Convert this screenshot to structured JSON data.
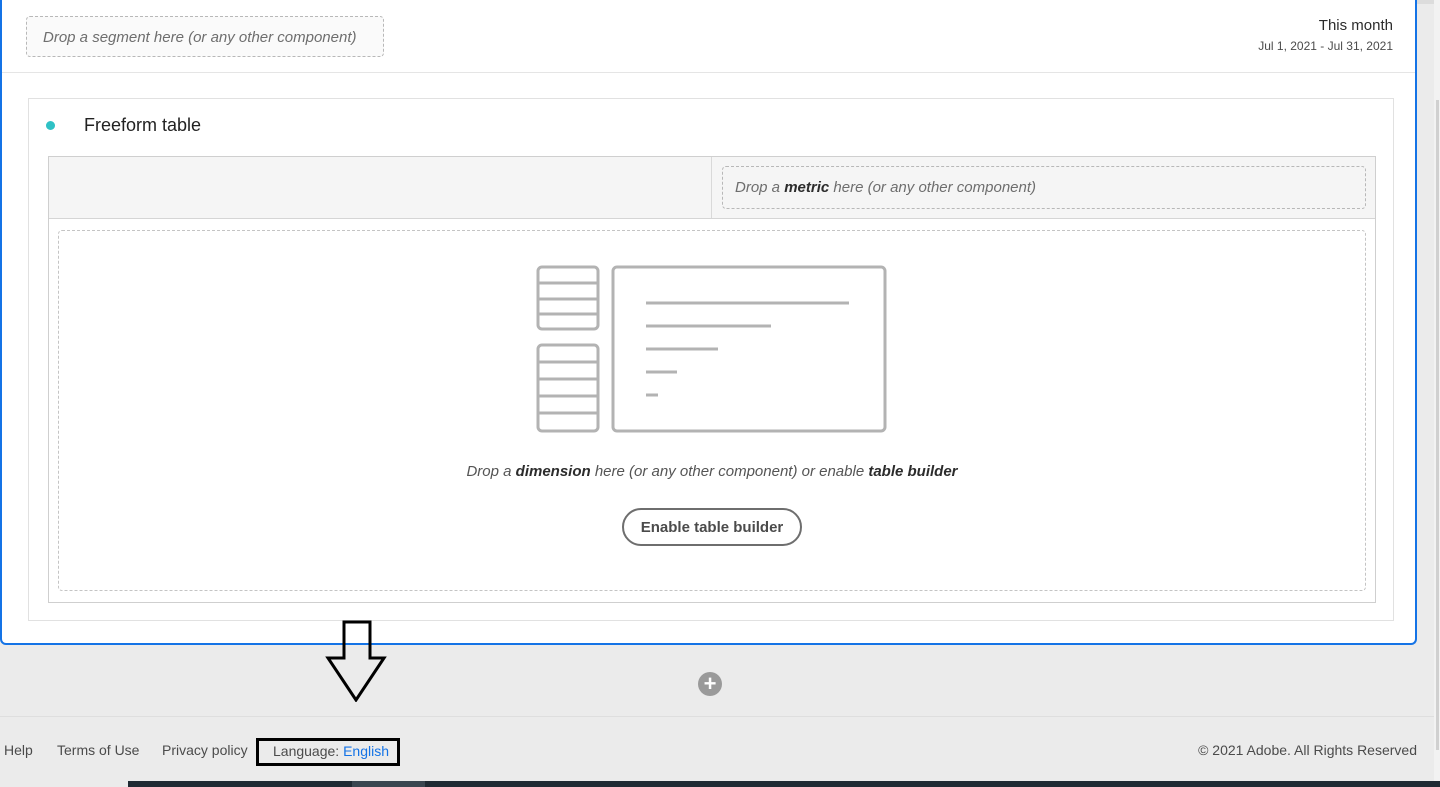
{
  "panel": {
    "segment_drop_text": "Drop a segment here (or any other component)",
    "date_label": "This month",
    "date_range": "Jul 1, 2021 - Jul 31, 2021"
  },
  "visualization": {
    "title": "Freeform table",
    "status_dot_color": "#2fc1c5",
    "metric_drop": {
      "prefix": "Drop a ",
      "strong": "metric",
      "suffix": " here (or any other component)"
    },
    "dimension_drop": {
      "prefix": "Drop a ",
      "strong1": "dimension",
      "middle": " here (or any other component) or enable ",
      "strong2": "table builder"
    },
    "enable_button_label": "Enable table builder"
  },
  "add_panel_icon": "plus-circle-icon",
  "annotation_icon": "down-arrow-icon",
  "footer": {
    "help": "Help",
    "terms": "Terms of Use",
    "privacy": "Privacy policy",
    "language_label": "Language: ",
    "language_value": "English",
    "copyright": "© 2021 Adobe. All Rights Reserved"
  },
  "colors": {
    "accent": "#1473e6",
    "link": "#1473e6"
  }
}
